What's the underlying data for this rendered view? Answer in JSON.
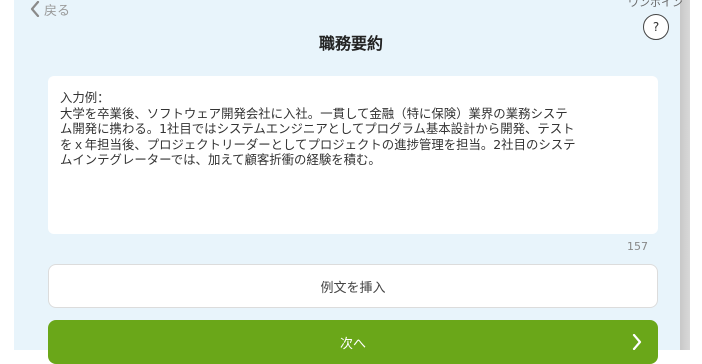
{
  "header": {
    "back_label": "戻る",
    "onepoint_label": "ワンポイン",
    "help_label": "?",
    "title": "職務要約"
  },
  "textarea": {
    "lines": [
      "入力例：",
      "大学を卒業後、ソフトウェア開発会社に入社。一貫して金融（特に保険）業界の業務システ",
      "ム開発に携わる。1社目ではシステムエンジニアとしてプログラム基本設計から開発、テスト",
      "をｘ年担当後、プロジェクトリーダーとしてプロジェクトの進捗管理を担当。2社目のシステ",
      "ムインテグレーターでは、加えて顧客折衝の経験を積む。"
    ],
    "char_count": "157"
  },
  "buttons": {
    "insert_example": "例文を挿入",
    "next": "次へ"
  },
  "icons": {
    "back": "chevron-left-icon",
    "next": "chevron-right-icon"
  },
  "colors": {
    "panel_bg": "#e8f4fb",
    "next_button": "#6aa719"
  }
}
